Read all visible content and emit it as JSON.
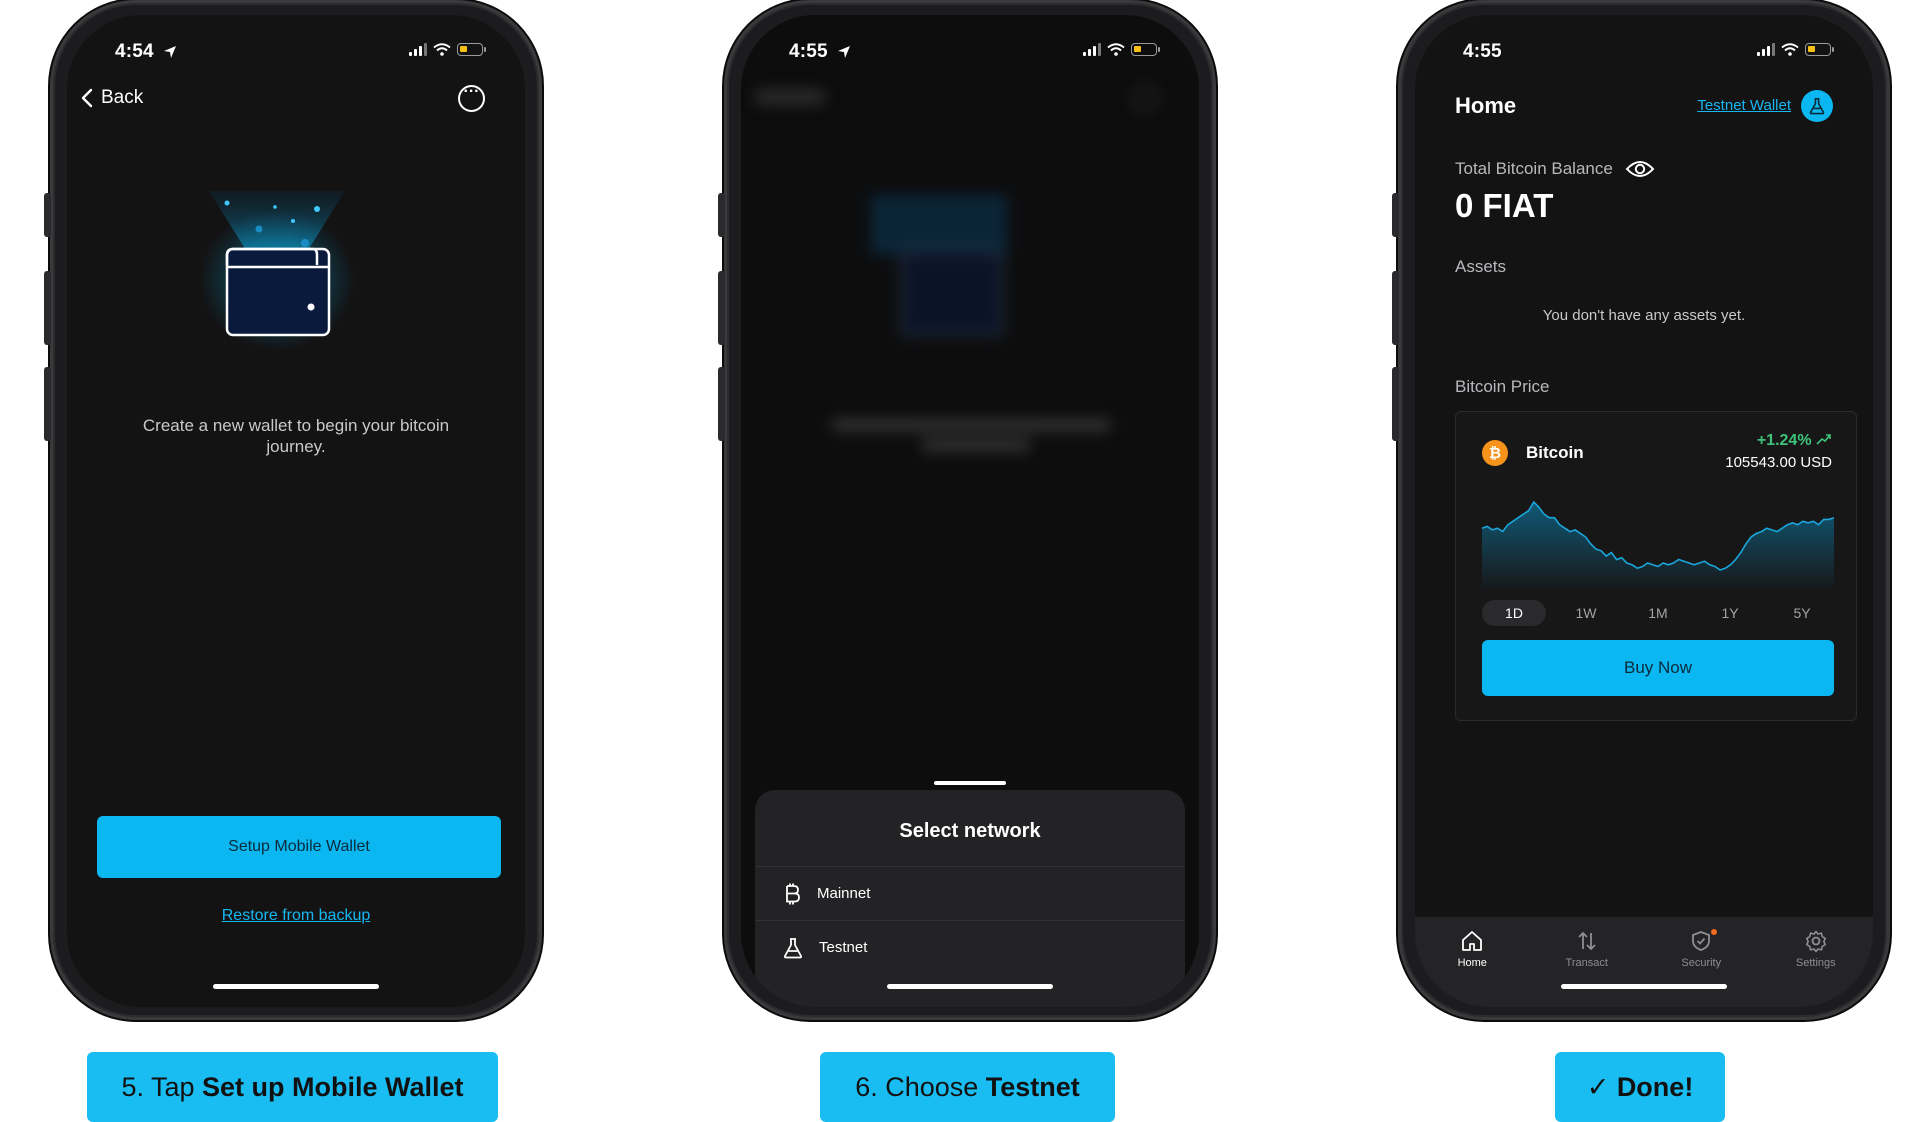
{
  "phones": [
    {
      "status_time": "4:54",
      "back_label": "Back",
      "intro_text": "Create a new wallet to begin your bitcoin journey.",
      "setup_button": "Setup Mobile Wallet",
      "restore_link": "Restore from backup"
    },
    {
      "status_time": "4:55",
      "sheet_title": "Select network",
      "networks": [
        {
          "label": "Mainnet",
          "icon": "bitcoin-icon"
        },
        {
          "label": "Testnet",
          "icon": "flask-icon"
        }
      ]
    },
    {
      "status_time": "4:55",
      "title": "Home",
      "wallet_link": "Testnet Wallet",
      "balance_label": "Total Bitcoin Balance",
      "balance_value": "0 FIAT",
      "assets_label": "Assets",
      "assets_empty": "You don't have any assets yet.",
      "price_label": "Bitcoin Price",
      "coin": {
        "name": "Bitcoin",
        "symbol": "₿",
        "change": "+1.24%",
        "price": "105543.00 USD"
      },
      "ranges": [
        "1D",
        "1W",
        "1M",
        "1Y",
        "5Y"
      ],
      "active_range": "1D",
      "buy_button": "Buy Now",
      "tabs": [
        {
          "label": "Home",
          "icon": "home-icon"
        },
        {
          "label": "Transact",
          "icon": "transfer-arrows-icon"
        },
        {
          "label": "Security",
          "icon": "shield-icon"
        },
        {
          "label": "Settings",
          "icon": "gear-icon"
        }
      ],
      "chart_data": {
        "type": "area",
        "series": [
          {
            "values": [
              58,
              59,
              57,
              58,
              56,
              60,
              62,
              64,
              66,
              68,
              73,
              70,
              66,
              64,
              64,
              60,
              58,
              56,
              57,
              55,
              53,
              49,
              46,
              45,
              42,
              44,
              40,
              41,
              38,
              37,
              35,
              36,
              38,
              37,
              36,
              38,
              37,
              38,
              40,
              39,
              38,
              37,
              38,
              39,
              37,
              36,
              34,
              35,
              37,
              40,
              44,
              49,
              53,
              55,
              56,
              58,
              57,
              56,
              58,
              60,
              61,
              60,
              62,
              61,
              62,
              60,
              63,
              63,
              64
            ]
          }
        ]
      }
    }
  ],
  "captions": [
    {
      "prefix": "5. Tap ",
      "bold": "Set up Mobile Wallet"
    },
    {
      "prefix": "6. Choose ",
      "bold": "Testnet"
    },
    {
      "prefix": "✓ ",
      "bold": "Done!"
    }
  ],
  "colors": {
    "accent": "#0bb7f0",
    "link": "#17b7f3",
    "screen_bg": "#131314",
    "positive": "#3ec47a",
    "bitcoin": "#f7931a"
  }
}
